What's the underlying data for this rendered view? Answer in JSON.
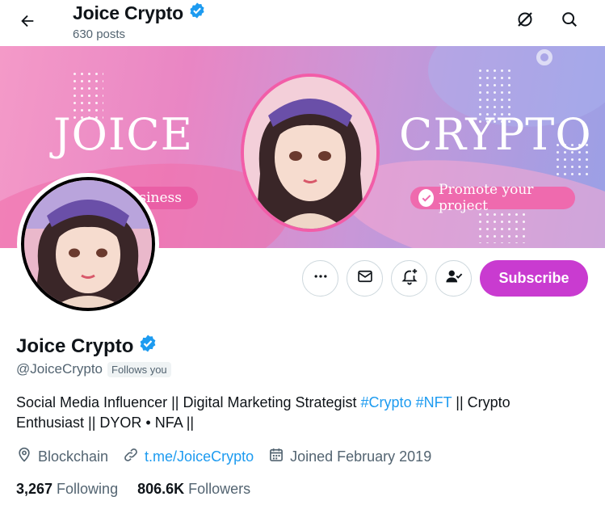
{
  "header": {
    "name": "Joice Crypto",
    "posts": "630 posts",
    "icons": [
      "arrow-left-icon",
      "verified-badge-icon",
      "grok-icon",
      "search-icon"
    ]
  },
  "banner": {
    "left_word": "JOICE",
    "right_word": "CRYPTO",
    "left_pill": "Business",
    "right_pill": "Promote your project"
  },
  "actions": {
    "more_icon": "ellipsis-icon",
    "message_icon": "envelope-icon",
    "notify_icon": "bell-plus-icon",
    "following_icon": "person-check-icon",
    "subscribe_label": "Subscribe"
  },
  "profile": {
    "name": "Joice Crypto",
    "handle": "@JoiceCrypto",
    "follows_you": "Follows you",
    "bio_prefix": "Social Media Influencer || Digital Marketing Strategist ",
    "bio_tag1": "#Crypto",
    "bio_space": " ",
    "bio_tag2": "#NFT",
    "bio_suffix": " || Crypto Enthusiast  || DYOR • NFA ||",
    "location": "Blockchain",
    "link": "t.me/JoiceCrypto",
    "joined": "Joined February 2019",
    "following_count": "3,267",
    "following_label": "Following",
    "followers_count": "806.6K",
    "followers_label": "Followers"
  },
  "colors": {
    "accent": "#1d9bf0",
    "subscribe": "#c93bd0",
    "muted": "#536471",
    "verified": "#1d9bf0"
  }
}
